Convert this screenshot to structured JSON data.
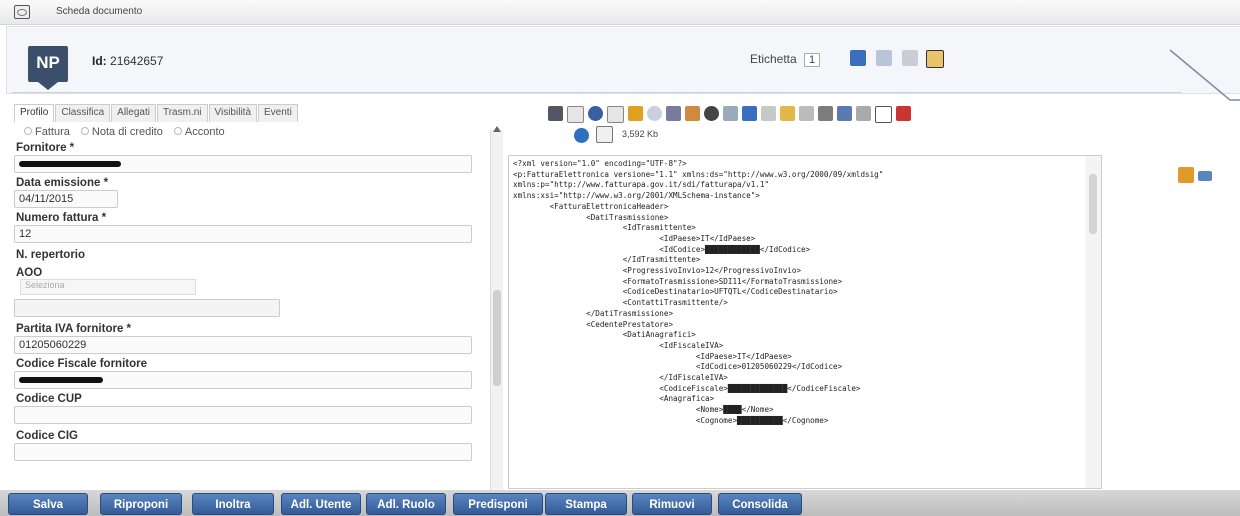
{
  "window": {
    "title": "Scheda documento"
  },
  "header": {
    "badge": "NP",
    "id_label": "Id:",
    "id_value": "21642657",
    "etichetta_label": "Etichetta",
    "etichetta_value": "1"
  },
  "tabs": [
    "Profilo",
    "Classifica",
    "Allegati",
    "Trasm.ni",
    "Visibilità",
    "Eventi"
  ],
  "form": {
    "doc_types": [
      "Fattura",
      "Nota di credito",
      "Acconto"
    ],
    "fornitore_label": "Fornitore *",
    "data_emissione_label": "Data emissione *",
    "data_emissione_value": "04/11/2015",
    "numero_fattura_label": "Numero fattura *",
    "numero_fattura_value": "12",
    "repertorio_label": "N. repertorio",
    "aoo_label": "AOO",
    "aoo_select": "Seleziona",
    "partita_iva_label": "Partita IVA fornitore *",
    "partita_iva_value": "01205060229",
    "codice_fiscale_label": "Codice Fiscale fornitore",
    "cup_label": "Codice CUP",
    "cig_label": "Codice CIG"
  },
  "viewer": {
    "file_size": "3,592 Kb",
    "xml_lines": [
      "<?xml version=\"1.0\" encoding=\"UTF-8\"?>",
      "<p:FatturaElettronica versione=\"1.1\" xmlns:ds=\"http://www.w3.org/2000/09/xmldsig\"",
      "xmlns:p=\"http://www.fatturapa.gov.it/sdi/fatturapa/v1.1\"",
      "xmlns:xsi=\"http://www.w3.org/2001/XMLSchema-instance\">",
      "        <FatturaElettronicaHeader>",
      "                <DatiTrasmissione>",
      "                        <IdTrasmittente>",
      "                                <IdPaese>IT</IdPaese>",
      "                                <IdCodice>████████████</IdCodice>",
      "                        </IdTrasmittente>",
      "                        <ProgressivoInvio>12</ProgressivoInvio>",
      "                        <FormatoTrasmissione>SDI11</FormatoTrasmissione>",
      "                        <CodiceDestinatario>UFTQTL</CodiceDestinatario>",
      "                        <ContattiTrasmittente/>",
      "                </DatiTrasmissione>",
      "                <CedentePrestatore>",
      "                        <DatiAnagrafici>",
      "                                <IdFiscaleIVA>",
      "                                        <IdPaese>IT</IdPaese>",
      "                                        <IdCodice>01205060229</IdCodice>",
      "                                </IdFiscaleIVA>",
      "                                <CodiceFiscale>█████████████</CodiceFiscale>",
      "                                <Anagrafica>",
      "                                        <Nome>████</Nome>",
      "                                        <Cognome>██████████</Cognome>"
    ]
  },
  "buttons": [
    "Salva",
    "Riproponi",
    "Inoltra",
    "Adl. Utente",
    "Adl. Ruolo",
    "Predisponi",
    "Stampa",
    "Rimuovi",
    "Consolida"
  ],
  "colors": {
    "button": "#3f6aa8",
    "badge": "#3b4f6b"
  }
}
